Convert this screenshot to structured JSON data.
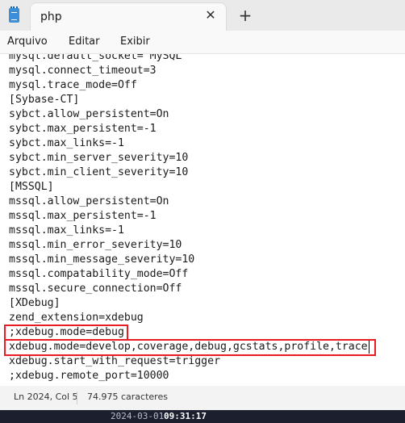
{
  "app": {
    "icon": "notepad-icon"
  },
  "tab": {
    "title": "php",
    "close_glyph": "✕",
    "new_glyph": "+"
  },
  "menu": [
    "Arquivo",
    "Editar",
    "Exibir"
  ],
  "editor": {
    "partial_top_line": "mysql.default_socket= MySQL",
    "lines": [
      "mysql.connect_timeout=3",
      "mysql.trace_mode=Off",
      "[Sybase-CT]",
      "sybct.allow_persistent=On",
      "sybct.max_persistent=-1",
      "sybct.max_links=-1",
      "sybct.min_server_severity=10",
      "sybct.min_client_severity=10",
      "[MSSQL]",
      "mssql.allow_persistent=On",
      "mssql.max_persistent=-1",
      "mssql.max_links=-1",
      "mssql.min_error_severity=10",
      "mssql.min_message_severity=10",
      "mssql.compatability_mode=Off",
      "mssql.secure_connection=Off",
      "[XDebug]",
      "zend_extension=xdebug",
      ";xdebug.mode=debug",
      "xdebug.mode=develop,coverage,debug,gcstats,profile,trace",
      "xdebug.start_with_request=trigger",
      ";xdebug.remote_port=10000"
    ],
    "highlight_color": "#e81c24"
  },
  "status": {
    "position": "Ln 2024, Col 5",
    "chars": "74.975 caracteres"
  },
  "taskbar": {
    "date": "2024-03-01",
    "time": "09:31:17"
  }
}
